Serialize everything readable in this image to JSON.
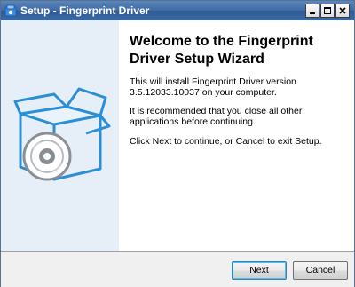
{
  "window": {
    "title": "Setup - Fingerprint Driver"
  },
  "main": {
    "heading": "Welcome to the Fingerprint Driver Setup Wizard",
    "paragraphs": [
      "This will install Fingerprint Driver version 3.5.12033.10037 on your computer.",
      "It is recommended that you close all other applications before continuing.",
      "Click Next to continue, or Cancel to exit Setup."
    ]
  },
  "buttons": {
    "next_label": "Next",
    "cancel_label": "Cancel"
  },
  "icons": {
    "title": "setup-installer-icon",
    "art": "software-box-disc-icon"
  },
  "colors": {
    "left_panel": "#e6eff8",
    "box_blue": "#2b8fd6",
    "disc_gray": "#8a8f96"
  }
}
